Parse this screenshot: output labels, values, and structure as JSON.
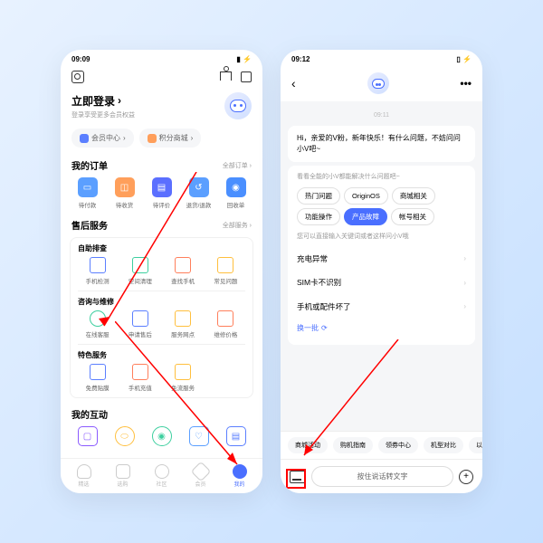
{
  "left": {
    "time": "09:09",
    "status_icons": "◉ ⬡ ⬢ ◈",
    "battery": "▮ ⚡",
    "login_title": "立即登录",
    "login_sub": "登录享受更多会员权益",
    "pill_member": "会员中心",
    "pill_points": "积分商城",
    "orders_title": "我的订单",
    "orders_all": "全部订单",
    "orders": [
      "待付款",
      "待收货",
      "待评价",
      "退货/退款",
      "回收单"
    ],
    "service_title": "售后服务",
    "service_all": "全部服务",
    "self_title": "自助排查",
    "self": [
      "手机检测",
      "空间清理",
      "查找手机",
      "常见问题"
    ],
    "consult_title": "咨询与维修",
    "consult": [
      "在线客服",
      "申请售后",
      "服务网点",
      "维修价格"
    ],
    "special_title": "特色服务",
    "special": [
      "免费贴膜",
      "手机充值",
      "免流服务"
    ],
    "interact_title": "我的互动",
    "tabs": [
      "精选",
      "选购",
      "社区",
      "会员",
      "我的"
    ]
  },
  "right": {
    "time": "09:12",
    "status_icons": "◉ ⬢ ◈ ◈",
    "battery": "▯ ⚡",
    "ts": "09:11",
    "greeting": "Hi，亲爱的V粉，新年快乐！有什么问题，不妨问问小V吧~",
    "hint": "看看全能的小V都能解决什么问题吧~",
    "chips": [
      "热门问题",
      "OriginOS",
      "商城相关",
      "功能操作",
      "产品故障",
      "帐号相关"
    ],
    "hint2": "您可以直接输入关键词或者这样问小V哦",
    "rows": [
      "充电异常",
      "SIM卡不识别",
      "手机或配件坏了"
    ],
    "refresh": "换一批",
    "bottom_chips": [
      "商城活动",
      "购机指南",
      "领券中心",
      "机型对比",
      "以"
    ],
    "voice": "按住说话转文字"
  }
}
